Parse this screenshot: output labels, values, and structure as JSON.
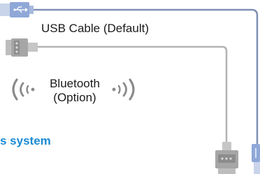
{
  "usb_cable_label": "USB Cable (Default)",
  "bluetooth_label_line1": "Bluetooth",
  "bluetooth_label_line2": "(Option)",
  "system_label": "s system",
  "colors": {
    "cable_gray": "#b3b3b3",
    "usb_cable_blue": "#7d8fb3",
    "connector_gray": "#9a9a9a",
    "usb_plug_blue": "#8fa8d8",
    "system_text_blue": "#1a8ad4",
    "wave_gray": "#8a8a8a"
  },
  "icons": [
    "usb-symbol-icon",
    "serial-connector-icon",
    "bluetooth-wave-left-icon",
    "bluetooth-wave-right-icon"
  ]
}
